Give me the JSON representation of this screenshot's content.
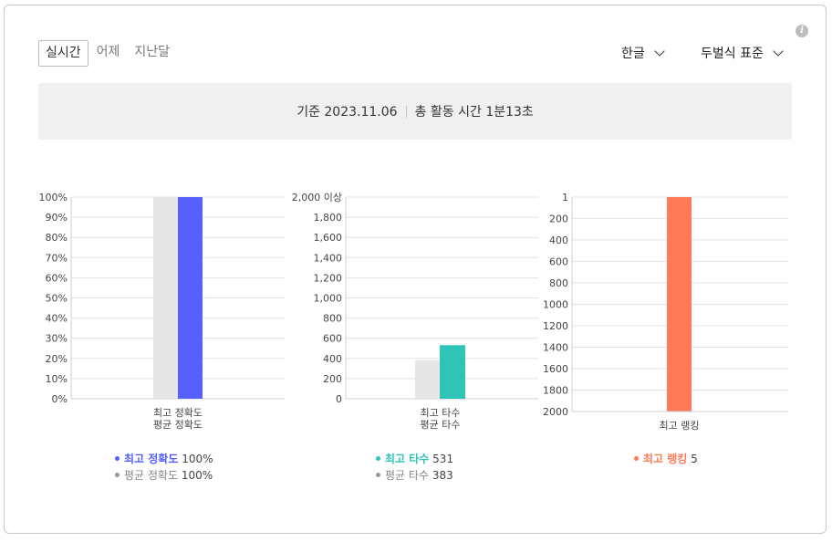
{
  "tabs": [
    "실시간",
    "어제",
    "지난달"
  ],
  "active_tab": 0,
  "dropdowns": {
    "language": "한글",
    "layout": "두벌식 표준"
  },
  "summary": {
    "date_label": "기준 2023.11.06",
    "time_label": "총 활동 시간 1분13초"
  },
  "colors": {
    "accuracy": "#5560ff",
    "speed": "#2ec4b6",
    "ranking": "#ff7a59",
    "average": "#e6e6e6",
    "avg_dot": "#999999"
  },
  "chart_data": [
    {
      "type": "bar",
      "categories": [
        "최고 정확도\n평균 정확도"
      ],
      "series": [
        {
          "name": "평균 정확도",
          "values": [
            100
          ]
        },
        {
          "name": "최고 정확도",
          "values": [
            100
          ]
        }
      ],
      "ylim": [
        0,
        100
      ],
      "ticks": [
        "0%",
        "10%",
        "20%",
        "30%",
        "40%",
        "50%",
        "60%",
        "70%",
        "80%",
        "90%",
        "100%"
      ],
      "tick_values": [
        0,
        10,
        20,
        30,
        40,
        50,
        60,
        70,
        80,
        90,
        100
      ],
      "xlabel_lines": [
        "최고 정확도",
        "평균 정확도"
      ],
      "legend": [
        {
          "label": "최고 정확도",
          "value": "100%"
        },
        {
          "label": "평균 정확도",
          "value": "100%"
        }
      ]
    },
    {
      "type": "bar",
      "categories": [
        "최고 타수\n평균 타수"
      ],
      "series": [
        {
          "name": "평균 타수",
          "values": [
            383
          ]
        },
        {
          "name": "최고 타수",
          "values": [
            531
          ]
        }
      ],
      "ylim": [
        0,
        2000
      ],
      "ticks": [
        "0",
        "200",
        "400",
        "600",
        "800",
        "1,000",
        "1,200",
        "1,400",
        "1,600",
        "1,800",
        "2,000 이상"
      ],
      "tick_values": [
        0,
        200,
        400,
        600,
        800,
        1000,
        1200,
        1400,
        1600,
        1800,
        2000
      ],
      "xlabel_lines": [
        "최고 타수",
        "평균 타수"
      ],
      "legend": [
        {
          "label": "최고 타수",
          "value": "531"
        },
        {
          "label": "평균 타수",
          "value": "383"
        }
      ]
    },
    {
      "type": "bar",
      "categories": [
        "최고 랭킹"
      ],
      "series": [
        {
          "name": "최고 랭킹",
          "values": [
            5
          ]
        }
      ],
      "ylim": [
        1,
        2000
      ],
      "inverted": true,
      "ticks": [
        "1",
        "200",
        "400",
        "600",
        "800",
        "1000",
        "1200",
        "1400",
        "1600",
        "1800",
        "2000"
      ],
      "tick_values": [
        1,
        200,
        400,
        600,
        800,
        1000,
        1200,
        1400,
        1600,
        1800,
        2000
      ],
      "xlabel_lines": [
        "최고 랭킹"
      ],
      "legend": [
        {
          "label": "최고 랭킹",
          "value": "5"
        }
      ]
    }
  ]
}
